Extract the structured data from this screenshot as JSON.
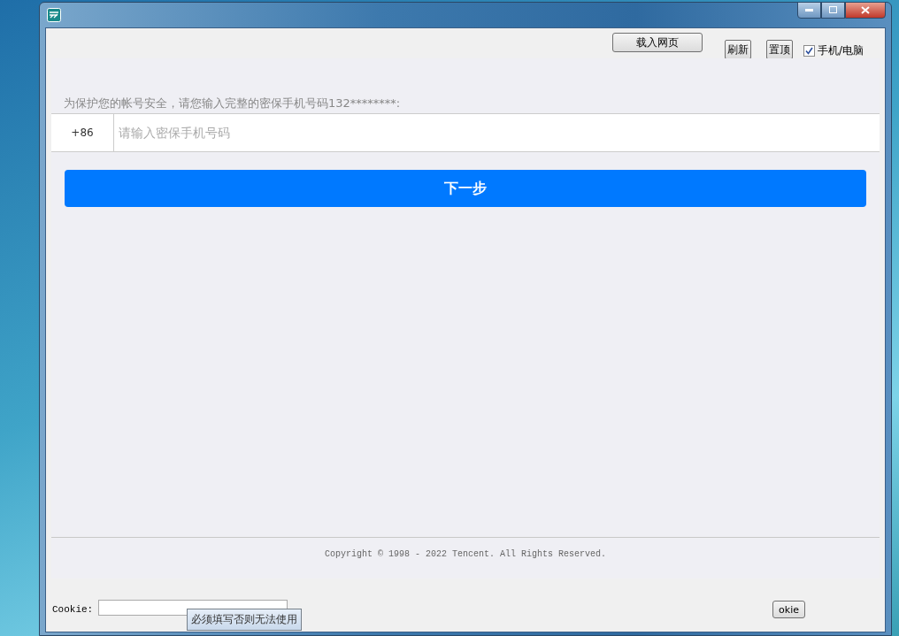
{
  "toolbar": {
    "load_button": "载入网页",
    "refresh_button": "刷新",
    "pin_button": "置顶",
    "mode_checkbox": {
      "label": "手机/电脑",
      "checked": true
    }
  },
  "page": {
    "prompt": "为保护您的帐号安全，请您输入完整的密保手机号码132********:",
    "country_code": "+86",
    "phone_placeholder": "请输入密保手机号码",
    "next_button": "下一步",
    "copyright": "Copyright © 1998 - 2022 Tencent. All Rights Reserved."
  },
  "bottom_bar": {
    "cookie_label": "Cookie:",
    "tooltip": "必须填写否则无法使用",
    "button_partial": "okie"
  }
}
